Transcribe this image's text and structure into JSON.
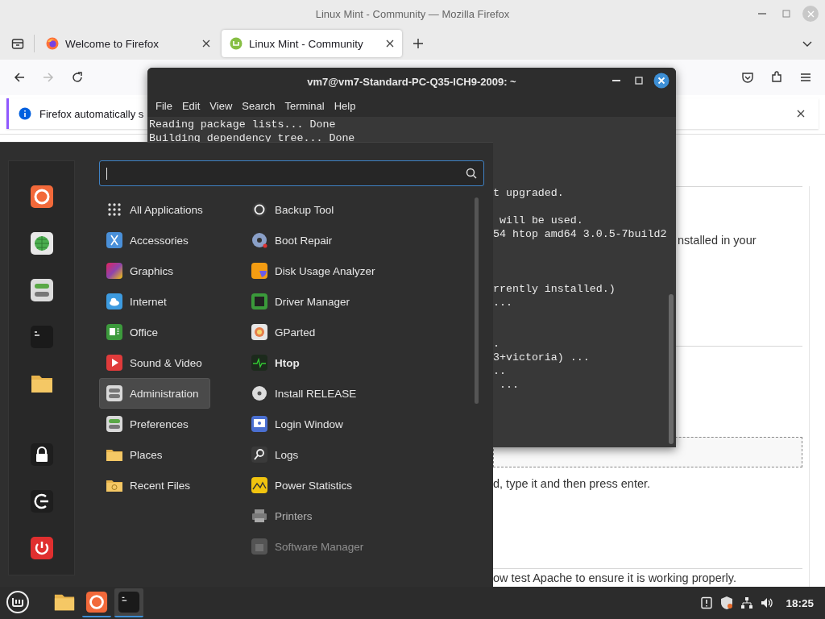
{
  "firefox": {
    "title": "Linux Mint - Community — Mozilla Firefox",
    "tabs": [
      {
        "label": "Welcome to Firefox",
        "selected": false
      },
      {
        "label": "Linux Mint - Community",
        "selected": true
      }
    ],
    "navigation": {
      "forward_disabled": true
    },
    "notification": {
      "text": "Firefox automatically s"
    },
    "page": {
      "paragraphs": [
        "nstalled in your",
        "d, type it and then press enter.",
        "ow test Apache to ensure it is working properly."
      ]
    }
  },
  "terminal": {
    "title": "vm7@vm7-Standard-PC-Q35-ICH9-2009: ~",
    "menu": [
      "File",
      "Edit",
      "View",
      "Search",
      "Terminal",
      "Help"
    ],
    "lines": [
      "Reading package lists... Done",
      "Building dependency tree... Done",
      "t upgraded.",
      " will be used.",
      "54 htop amd64 3.0.5-7build2",
      "rrently installed.)",
      "...",
      ".",
      "3+victoria) ...",
      "..",
      " ..."
    ]
  },
  "menu": {
    "categories": [
      {
        "label": "All Applications",
        "selected": false
      },
      {
        "label": "Accessories",
        "selected": false
      },
      {
        "label": "Graphics",
        "selected": false
      },
      {
        "label": "Internet",
        "selected": false
      },
      {
        "label": "Office",
        "selected": false
      },
      {
        "label": "Sound & Video",
        "selected": false
      },
      {
        "label": "Administration",
        "selected": true
      },
      {
        "label": "Preferences",
        "selected": false
      },
      {
        "label": "Places",
        "selected": false
      },
      {
        "label": "Recent Files",
        "selected": false
      }
    ],
    "apps": [
      {
        "label": "Backup Tool",
        "kind": "app"
      },
      {
        "label": "Boot Repair",
        "kind": "app"
      },
      {
        "label": "Disk Usage Analyzer",
        "kind": "app"
      },
      {
        "label": "Driver Manager",
        "kind": "app"
      },
      {
        "label": "GParted",
        "kind": "app"
      },
      {
        "label": "Htop",
        "kind": "new"
      },
      {
        "label": "Install RELEASE",
        "kind": "app"
      },
      {
        "label": "Login Window",
        "kind": "app"
      },
      {
        "label": "Logs",
        "kind": "app"
      },
      {
        "label": "Power Statistics",
        "kind": "app"
      },
      {
        "label": "Printers",
        "kind": "dimmed"
      },
      {
        "label": "Software Manager",
        "kind": "faded"
      }
    ]
  },
  "taskbar": {
    "apps": [
      {
        "running": false,
        "focused": false
      },
      {
        "running": true,
        "focused": false
      },
      {
        "running": true,
        "focused": true
      }
    ],
    "clock": "18:25"
  }
}
